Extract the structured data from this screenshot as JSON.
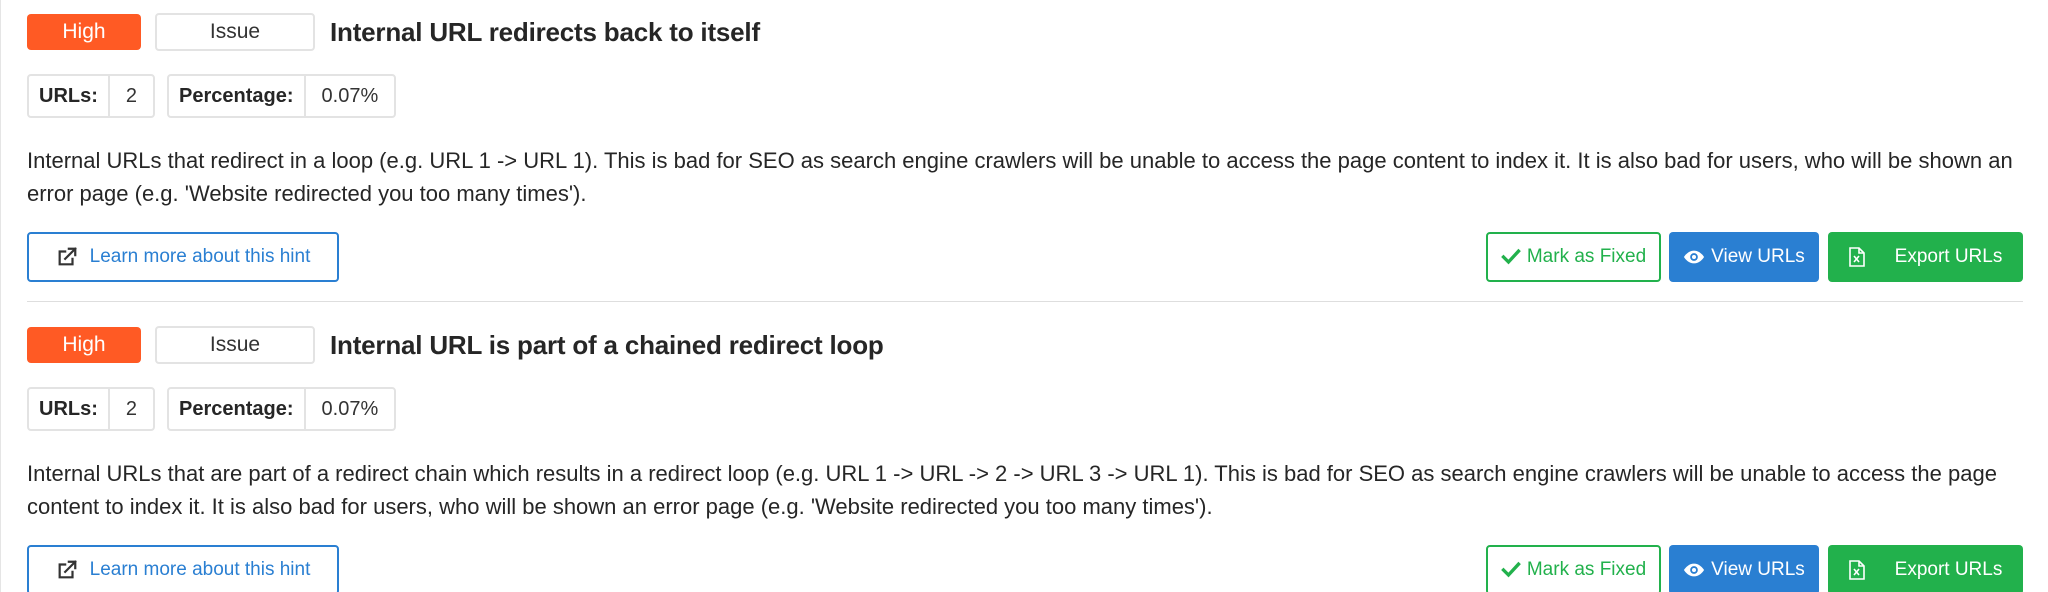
{
  "colors": {
    "high": "#ff5a24",
    "primary": "#2a7fd2",
    "success": "#22b14c",
    "border": "#e3e3e3"
  },
  "hints": [
    {
      "priority": "High",
      "type": "Issue",
      "title": "Internal URL redirects back to itself",
      "urls_label": "URLs:",
      "urls_value": "2",
      "percentage_label": "Percentage:",
      "percentage_value": "0.07%",
      "description": "Internal URLs that redirect in a loop (e.g. URL 1 -> URL 1). This is bad for SEO as search engine crawlers will be unable to access the page content to index it. It is also bad for users, who will be shown an error page (e.g. 'Website redirected you too many times').",
      "learn_more": "Learn more about this hint",
      "mark_fixed": "Mark as Fixed",
      "view_urls": "View URLs",
      "export_urls": "Export URLs"
    },
    {
      "priority": "High",
      "type": "Issue",
      "title": "Internal URL is part of a chained redirect loop",
      "urls_label": "URLs:",
      "urls_value": "2",
      "percentage_label": "Percentage:",
      "percentage_value": "0.07%",
      "description": "Internal URLs that are part of a redirect chain which results in a redirect loop (e.g. URL 1 -> URL -> 2 -> URL 3 -> URL 1). This is bad for SEO as search engine crawlers will be unable to access the page content to index it. It is also bad for users, who will be shown an error page (e.g. 'Website redirected you too many times').",
      "learn_more": "Learn more about this hint",
      "mark_fixed": "Mark as Fixed",
      "view_urls": "View URLs",
      "export_urls": "Export URLs"
    }
  ],
  "icons": {
    "learn_more": "external-link-icon",
    "mark_fixed": "check-icon",
    "view_urls": "eye-icon",
    "export_urls": "excel-file-icon"
  }
}
